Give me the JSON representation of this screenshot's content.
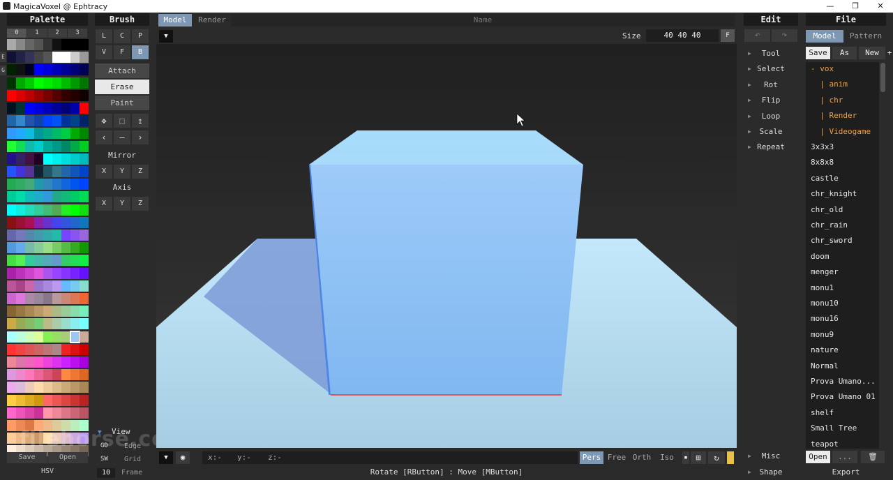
{
  "window": {
    "title": "MagicaVoxel @ Ephtracy",
    "min_icon": "minimize-icon",
    "max_icon": "maximize-icon",
    "close_icon": "close-icon"
  },
  "palette": {
    "header": "Palette",
    "tabs": [
      "0",
      "1",
      "2",
      "3"
    ],
    "side_labels": [
      "E",
      "G"
    ],
    "save": "Save",
    "open": "Open",
    "hsv": "HSV",
    "colors": [
      [
        "#aaaaaa",
        "#888888",
        "#666666",
        "#555555",
        "#333333",
        "#111111",
        "#000000",
        "#000000",
        "#000000"
      ],
      [
        "#111133",
        "#222244",
        "#333355",
        "#444444",
        "#555555",
        "#ffffff",
        "#ffffff",
        "#cccccc",
        "#999999"
      ],
      [
        "#002200",
        "#111111",
        "#000022",
        "#0000ff",
        "#0000dd",
        "#0000bb",
        "#000099",
        "#000077",
        "#000055"
      ],
      [
        "#003300",
        "#00aa00",
        "#00cc00",
        "#00ff00",
        "#00ee00",
        "#00dd00",
        "#00bb00",
        "#009900",
        "#007700"
      ],
      [
        "#ff0000",
        "#dd0000",
        "#bb0000",
        "#990000",
        "#770000",
        "#550000",
        "#330000",
        "#220000",
        "#110000"
      ],
      [
        "#001122",
        "#003333",
        "#0000ff",
        "#0000dd",
        "#0000bb",
        "#000099",
        "#000077",
        "#0000aa",
        "#ff0000"
      ],
      [
        "#2266aa",
        "#3388cc",
        "#2255aa",
        "#1144aa",
        "#0044ff",
        "#0055ee",
        "#003399",
        "#004488",
        "#002266"
      ],
      [
        "#3399ff",
        "#22aaff",
        "#11bbdd",
        "#009999",
        "#00aa88",
        "#00bb66",
        "#00cc44",
        "#00aa00",
        "#008800"
      ],
      [
        "#22ff33",
        "#11dd55",
        "#11bbaa",
        "#00cccc",
        "#00aa99",
        "#009988",
        "#008866",
        "#00aa44",
        "#00cc22"
      ],
      [
        "#221188",
        "#332266",
        "#441144",
        "#220022",
        "#00ffff",
        "#00eeee",
        "#00dddd",
        "#00cccc",
        "#00bbbb"
      ],
      [
        "#2255ff",
        "#4433dd",
        "#553399",
        "#112233",
        "#225566",
        "#337788",
        "#2266aa",
        "#1155bb",
        "#0044cc"
      ],
      [
        "#22aa55",
        "#33aa66",
        "#44aa77",
        "#2299aa",
        "#3388bb",
        "#2277cc",
        "#1166dd",
        "#0055ee",
        "#0044ff"
      ],
      [
        "#00cc99",
        "#00ddaa",
        "#11bbbb",
        "#22aacc",
        "#3399dd",
        "#22aa88",
        "#11bb77",
        "#00cc66",
        "#00dd55"
      ],
      [
        "#00ffff",
        "#11eedd",
        "#22ddbb",
        "#33cc99",
        "#44bb77",
        "#55aa55",
        "#22ee22",
        "#00ff00",
        "#11dd11"
      ],
      [
        "#881111",
        "#991133",
        "#aa1155",
        "#8822aa",
        "#6633cc",
        "#4444ee",
        "#3355dd",
        "#2266cc",
        "#1177bb"
      ],
      [
        "#6666aa",
        "#7777bb",
        "#5588aa",
        "#4499aa",
        "#33aaaa",
        "#22bbaa",
        "#7744ff",
        "#8855ee",
        "#9966dd"
      ],
      [
        "#5599dd",
        "#66aaee",
        "#77bbaa",
        "#88cc99",
        "#99dd88",
        "#77cc66",
        "#55bb44",
        "#33aa22",
        "#119900"
      ],
      [
        "#44dd44",
        "#55ee55",
        "#33cc99",
        "#44bbaa",
        "#55aabb",
        "#6699cc",
        "#33cc66",
        "#22dd55",
        "#11ee44"
      ],
      [
        "#aa22aa",
        "#bb33bb",
        "#cc44cc",
        "#dd55dd",
        "#aa55ee",
        "#9944ff",
        "#8833ff",
        "#7722ff",
        "#6611ff"
      ],
      [
        "#bb5599",
        "#aa4488",
        "#cc66aa",
        "#9977cc",
        "#aa88dd",
        "#bb99ee",
        "#66bbff",
        "#77ccee",
        "#88ddcc"
      ],
      [
        "#cc66cc",
        "#dd77dd",
        "#aa88aa",
        "#998899",
        "#887788",
        "#bb9999",
        "#cc8877",
        "#dd7755",
        "#ee6633"
      ],
      [
        "#886633",
        "#997744",
        "#aa8855",
        "#bb9966",
        "#ccaa77",
        "#aabb88",
        "#99cc99",
        "#88ddaa",
        "#77eebb"
      ],
      [
        "#ccaa44",
        "#99aa55",
        "#88bb66",
        "#77cc77",
        "#bbbb88",
        "#aaccaa",
        "#99ddcc",
        "#88eeee",
        "#77ffff"
      ],
      [
        "#aaffff",
        "#bbffdd",
        "#ccffbb",
        "#ddff99",
        "#88ee55",
        "#99dd66",
        "#aacc77",
        "#bbbb88",
        "#ccaa99"
      ],
      [
        "#ff3333",
        "#ee4444",
        "#dd5555",
        "#cc6666",
        "#bb7777",
        "#aa8888",
        "#ee2222",
        "#dd1111",
        "#cc0000"
      ],
      [
        "#ee8899",
        "#dd77aa",
        "#ee66bb",
        "#ff55cc",
        "#ee44dd",
        "#dd33ee",
        "#cc22ff",
        "#bb11ee",
        "#aa00dd"
      ],
      [
        "#dd99dd",
        "#ee88cc",
        "#ff77bb",
        "#ee6699",
        "#dd5577",
        "#cc4455",
        "#ff8844",
        "#ee7733",
        "#dd6622"
      ],
      [
        "#eeaaee",
        "#ddbbdd",
        "#eeccbb",
        "#ffddaa",
        "#eecc99",
        "#ddbb88",
        "#ccaa77",
        "#bb9966",
        "#aa8855"
      ],
      [
        "#ffcc44",
        "#eebb33",
        "#ddaa22",
        "#cc9911",
        "#ff6666",
        "#ee5555",
        "#dd4444",
        "#cc3333",
        "#bb2222"
      ],
      [
        "#ff66cc",
        "#ee55bb",
        "#dd44aa",
        "#cc3399",
        "#ff99aa",
        "#ee8899",
        "#dd7788",
        "#cc6677",
        "#bb5566"
      ],
      [
        "#ff9966",
        "#ee8855",
        "#dd7744",
        "#ffaa77",
        "#eebb88",
        "#ddcc99",
        "#ccddaa",
        "#bbeebb",
        "#aaffcc"
      ],
      [
        "#ffcc99",
        "#eebb88",
        "#ddaa77",
        "#cc9966",
        "#ffddaa",
        "#eeccbb",
        "#ddbbcc",
        "#ccaadd",
        "#bb99ee"
      ],
      [
        "#ffeedd",
        "#eeddcc",
        "#ddccbb",
        "#ccbbaa",
        "#bbaa99",
        "#aa9988",
        "#998877",
        "#887766",
        "#776655"
      ]
    ],
    "selected": {
      "row": 23,
      "col": 7,
      "color": "#9cc7f0"
    }
  },
  "brush": {
    "header": "Brush",
    "row1": [
      "L",
      "C",
      "P"
    ],
    "row2": [
      "V",
      "F",
      "B"
    ],
    "modes": [
      "Attach",
      "Erase",
      "Paint"
    ],
    "active_mode": "Erase",
    "mirror_label": "Mirror",
    "mirror": [
      "X",
      "Y",
      "Z"
    ],
    "axis_label": "Axis",
    "axis": [
      "X",
      "Y",
      "Z"
    ],
    "view_label": "View",
    "view_opts": [
      [
        "GD",
        "Edge"
      ],
      [
        "SW",
        "Grid"
      ],
      [
        "10",
        "Frame"
      ]
    ]
  },
  "viewport": {
    "tabs": [
      "Model",
      "Render"
    ],
    "name_placeholder": "Name",
    "size_label": "Size",
    "size_value": "40 40 40",
    "f_btn": "F",
    "coords": [
      "x:-",
      "y:-",
      "z:-"
    ],
    "proj": [
      "Pers",
      "Free",
      "Orth",
      "Iso"
    ],
    "active_proj": "Pers",
    "status": "Rotate [RButton] : Move [MButton]",
    "accent": "#7e98b3",
    "cube_color": "#8ec4f7",
    "ground_color": "#bde3fa"
  },
  "edit": {
    "header": "Edit",
    "undo_icon": "undo-icon",
    "redo_icon": "redo-icon",
    "items": [
      "Tool",
      "Select",
      "Rot",
      "Flip",
      "Loop",
      "Scale",
      "Repeat"
    ],
    "misc": "Misc",
    "shape": "Shape"
  },
  "file": {
    "header": "File",
    "tabs": [
      "Model",
      "Pattern"
    ],
    "actions": [
      "Save",
      "As",
      "New",
      "+"
    ],
    "items": [
      {
        "label": "- vox",
        "dir": true
      },
      {
        "label": "  | anim",
        "dir": true
      },
      {
        "label": "  | chr",
        "dir": true
      },
      {
        "label": "  | Render",
        "dir": true
      },
      {
        "label": "  | Videogame",
        "dir": true
      },
      {
        "label": "3x3x3",
        "dir": false
      },
      {
        "label": "8x8x8",
        "dir": false
      },
      {
        "label": "castle",
        "dir": false
      },
      {
        "label": "chr_knight",
        "dir": false
      },
      {
        "label": "chr_old",
        "dir": false
      },
      {
        "label": "chr_rain",
        "dir": false
      },
      {
        "label": "chr_sword",
        "dir": false
      },
      {
        "label": "doom",
        "dir": false
      },
      {
        "label": "menger",
        "dir": false
      },
      {
        "label": "monu1",
        "dir": false
      },
      {
        "label": "monu10",
        "dir": false
      },
      {
        "label": "monu16",
        "dir": false
      },
      {
        "label": "monu9",
        "dir": false
      },
      {
        "label": "nature",
        "dir": false
      },
      {
        "label": "Normal",
        "dir": false
      },
      {
        "label": "Prova Umano...",
        "dir": false
      },
      {
        "label": "Prova Umano 01",
        "dir": false
      },
      {
        "label": "shelf",
        "dir": false
      },
      {
        "label": "Small Tree",
        "dir": false
      },
      {
        "label": "teapot",
        "dir": false
      }
    ],
    "open": "Open",
    "more": "...",
    "export": "Export",
    "trash_icon": "trash-icon"
  }
}
